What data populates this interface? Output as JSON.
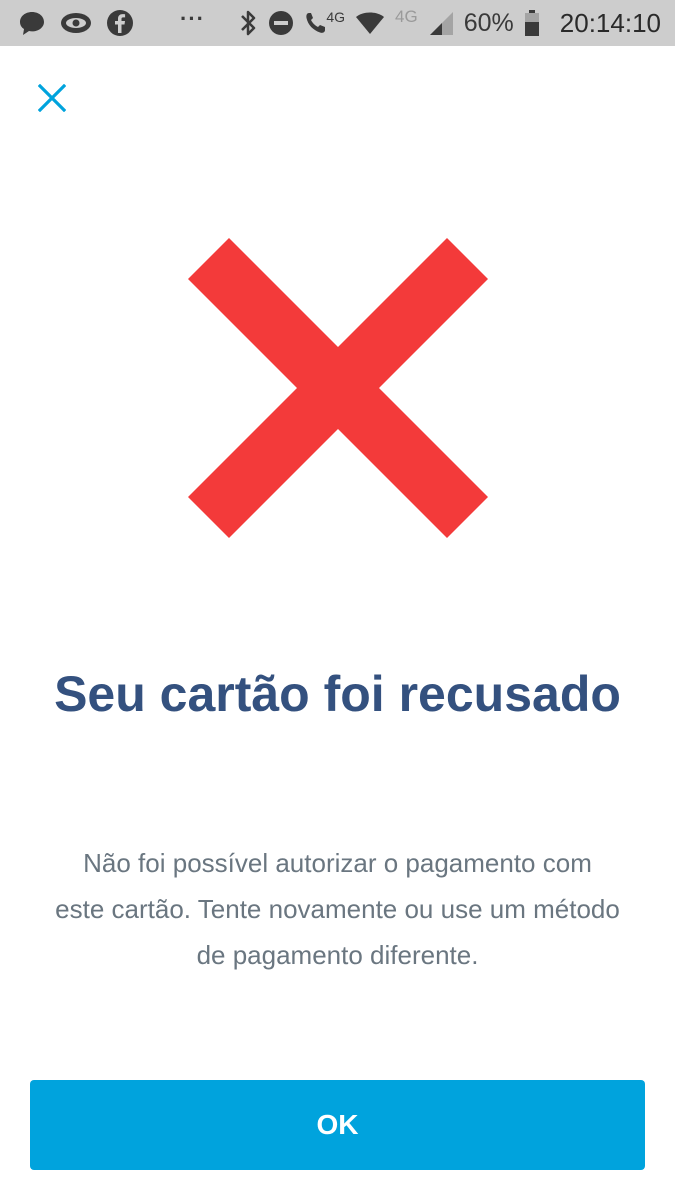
{
  "status_bar": {
    "left_icons": [
      "chat-bubble-icon",
      "eye-icon",
      "facebook-icon"
    ],
    "overflow": "···",
    "right_icons": [
      "bluetooth-icon",
      "do-not-disturb-icon",
      "call-4g-icon",
      "wifi-icon",
      "cellular-signal-icon",
      "battery-icon"
    ],
    "call_network": "4G",
    "network": "4G",
    "battery": "60%",
    "time": "20:14:10"
  },
  "close_icon": "close-icon",
  "error_icon": "error-cross-icon",
  "title": "Seu cartão foi recusado",
  "description": "Não foi possível autorizar o pagamento com este cartão. Tente novamente ou use um método de pagamento diferente.",
  "ok_label": "OK",
  "colors": {
    "status_bar_bg": "#cdcdcd",
    "accent": "#00a3dd",
    "error": "#f33a3a",
    "title": "#34517f",
    "body_text": "#6a7680"
  }
}
